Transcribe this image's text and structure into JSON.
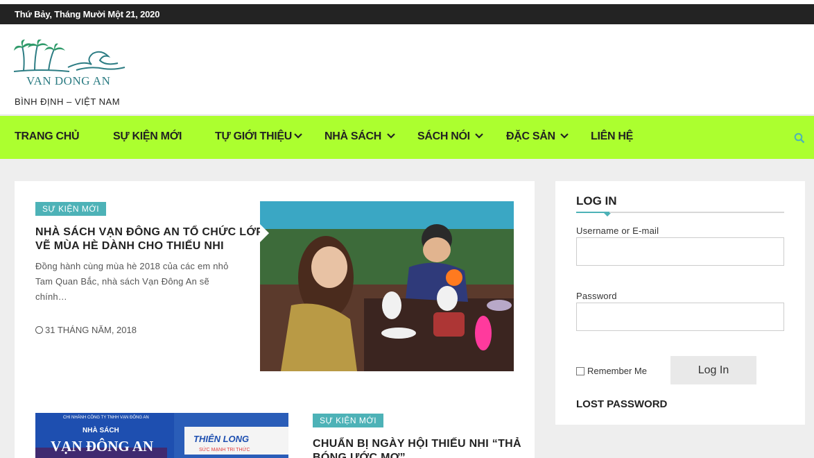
{
  "topbar": {
    "date": "Thứ Bảy, Tháng Mười Một 21, 2020"
  },
  "header": {
    "logo_text": "VAN DONG AN",
    "tagline": "BÌNH ĐỊNH – VIỆT NAM"
  },
  "nav": {
    "items": [
      {
        "label": "TRANG CHỦ"
      },
      {
        "label": "SỰ KIỆN MỚI"
      },
      {
        "label": "TỰ GIỚI THIỆU"
      },
      {
        "label": "NHÀ SÁCH"
      },
      {
        "label": "SÁCH NÓI"
      },
      {
        "label": "ĐẶC SẢN"
      },
      {
        "label": "LIÊN HỆ"
      }
    ],
    "search_icon": "search-icon"
  },
  "posts": [
    {
      "category": "SỰ KIỆN MỚI",
      "title_line1": "NHÀ SÁCH VẠN ĐÔNG AN TỔ CHỨC LỚP",
      "title_line2": "VẼ MÙA HÈ DÀNH CHO THIẾU NHI",
      "excerpt_line1": "Đồng hành cùng mùa hè 2018 của các em nhỏ",
      "excerpt_line2": "Tam Quan Bắc, nhà sách Vạn Đông An sẽ",
      "excerpt_line3": "chính…",
      "date": "31 THÁNG NĂM, 2018"
    },
    {
      "category": "SỰ KIỆN MỚI",
      "title_line1": "CHUẨN BỊ NGÀY HỘI THIẾU NHI “THẢ",
      "title_line2": "BÓNG ƯỚC MƠ”",
      "sign_line1": "CHI NHÁNH CÔNG TY TNHH VẠN ĐÔNG AN",
      "sign_line2": "NHÀ SÁCH",
      "sign_line3": "VẠN ĐÔNG AN",
      "sign_brand": "THIÊN LONG",
      "sign_slogan": "SỨC MẠNH TRI THỨC"
    }
  ],
  "login": {
    "title": "LOG IN",
    "username_label": "Username or E-mail",
    "password_label": "Password",
    "remember_label": "Remember Me",
    "button": "Log In",
    "lost": "LOST PASSWORD"
  },
  "colors": {
    "nav_bg": "#acff2f",
    "accent": "#4db2b7",
    "topbar": "#232323"
  }
}
